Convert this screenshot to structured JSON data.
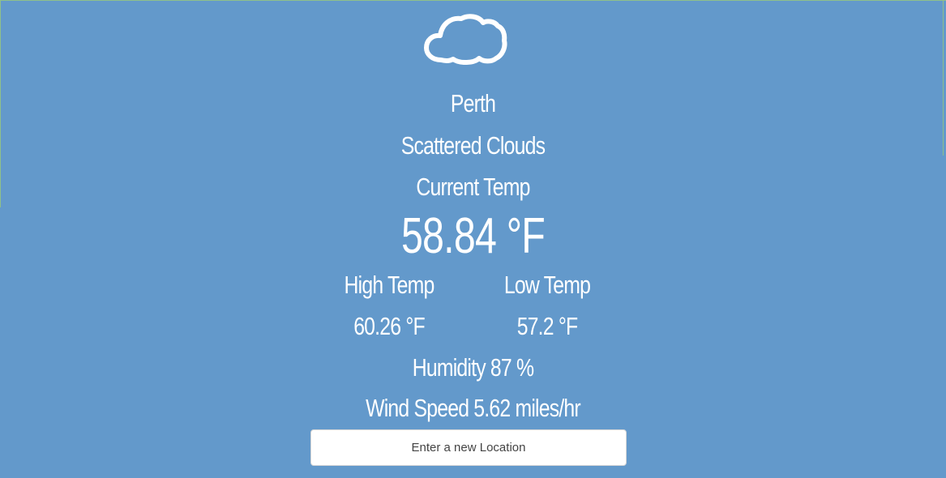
{
  "weather": {
    "icon": "cloud-icon",
    "city": "Perth",
    "description": "Scattered Clouds",
    "current_label": "Current Temp",
    "current_temp": "58.84 °F",
    "high_label": "High Temp",
    "high_temp": "60.26 °F",
    "low_label": "Low Temp",
    "low_temp": "57.2 °F",
    "humidity": "Humidity 87 %",
    "wind_speed": "Wind Speed 5.62 miles/hr"
  },
  "search": {
    "placeholder": "Enter a new Location",
    "value": ""
  },
  "colors": {
    "background": "#6399cb",
    "text": "#ffffff",
    "input_background": "#ffffff"
  }
}
